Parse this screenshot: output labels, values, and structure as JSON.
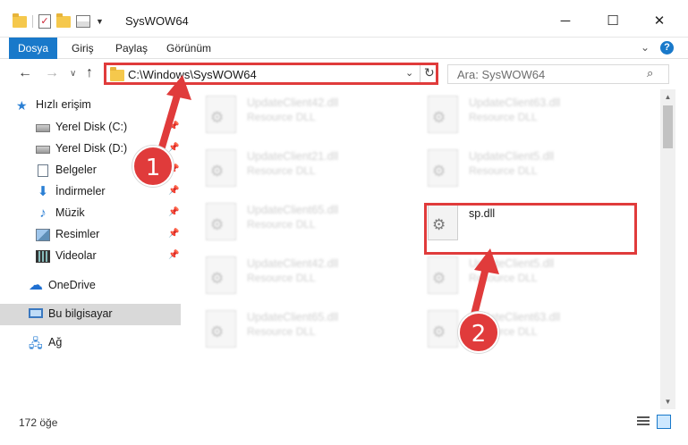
{
  "window": {
    "title": "SysWOW64",
    "controls": {
      "minimize": "─",
      "maximize": "☐",
      "close": "✕"
    }
  },
  "ribbon": {
    "tabs": [
      "Dosya",
      "Giriş",
      "Paylaş",
      "Görünüm"
    ],
    "help": "?"
  },
  "address": {
    "path": "C:\\Windows\\SysWOW64",
    "search_placeholder": "Ara: SysWOW64"
  },
  "sidebar": {
    "items": [
      {
        "label": "Hızlı erişim",
        "icon": "star-icon"
      },
      {
        "label": "Yerel Disk (C:)",
        "icon": "drive-icon",
        "pinned": true
      },
      {
        "label": "Yerel Disk (D:)",
        "icon": "drive-icon",
        "pinned": true
      },
      {
        "label": "Belgeler",
        "icon": "document-icon",
        "pinned": true
      },
      {
        "label": "İndirmeler",
        "icon": "download-icon",
        "pinned": true
      },
      {
        "label": "Müzik",
        "icon": "music-icon",
        "pinned": true
      },
      {
        "label": "Resimler",
        "icon": "pictures-icon",
        "pinned": true
      },
      {
        "label": "Videolar",
        "icon": "videos-icon",
        "pinned": true
      },
      {
        "label": "OneDrive",
        "icon": "cloud-icon"
      },
      {
        "label": "Bu bilgisayar",
        "icon": "computer-icon",
        "selected": true
      },
      {
        "label": "Ağ",
        "icon": "network-icon"
      }
    ]
  },
  "files": [
    {
      "name": "UpdateClient42.dll",
      "type": "Resource DLL",
      "blurred": true
    },
    {
      "name": "UpdateClient63.dll",
      "type": "Resource DLL",
      "blurred": true
    },
    {
      "name": "UpdateClient21.dll",
      "type": "Resource DLL",
      "blurred": true
    },
    {
      "name": "UpdateClient5.dll",
      "type": "Resource DLL",
      "blurred": true
    },
    {
      "name": "UpdateClient65.dll",
      "type": "Resource DLL",
      "blurred": true
    },
    {
      "name": "sp.dll",
      "type": "",
      "blurred": false,
      "highlighted": true
    },
    {
      "name": "UpdateClient42.dll",
      "type": "Resource DLL",
      "blurred": true
    },
    {
      "name": "UpdateClient5.dll",
      "type": "Resource DLL",
      "blurred": true
    },
    {
      "name": "UpdateClient65.dll",
      "type": "Resource DLL",
      "blurred": true
    },
    {
      "name": "UpdateClient63.dll",
      "type": "Resource DLL",
      "blurred": true
    }
  ],
  "status": {
    "item_count": "172 öğe"
  },
  "annotations": {
    "step1": "1",
    "step2": "2",
    "color": "#e03b3b"
  }
}
